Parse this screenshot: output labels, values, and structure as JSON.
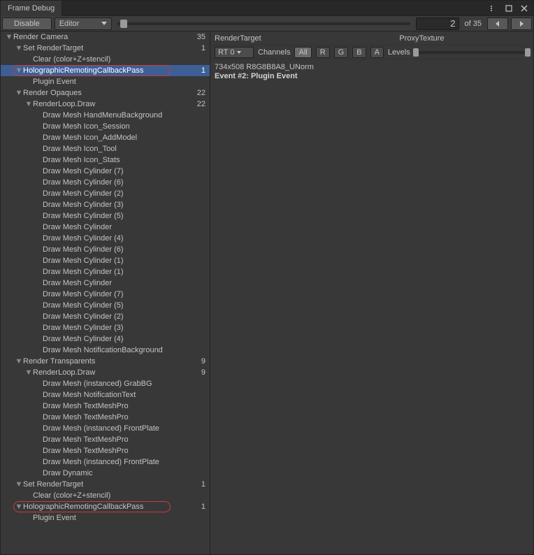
{
  "window": {
    "title": "Frame Debug"
  },
  "toolbar": {
    "disable": "Disable",
    "scope": "Editor",
    "current": "2",
    "total": "35",
    "of": "of"
  },
  "detail": {
    "renderTargetLabel": "RenderTarget",
    "renderTargetValue": "ProxyTexture",
    "rt": "RT 0",
    "channelsLabel": "Channels",
    "channels": [
      "All",
      "R",
      "G",
      "B",
      "A"
    ],
    "levelsLabel": "Levels",
    "texInfo": "734x508 R8G8B8A8_UNorm",
    "eventLine": "Event #2: Plugin Event"
  },
  "tree": [
    {
      "d": 0,
      "f": true,
      "label": "Render Camera",
      "count": "35"
    },
    {
      "d": 1,
      "f": true,
      "label": "Set RenderTarget",
      "count": "1"
    },
    {
      "d": 2,
      "f": false,
      "label": "Clear (color+Z+stencil)"
    },
    {
      "d": 1,
      "f": true,
      "label": "HolographicRemotingCallbackPass",
      "count": "1",
      "selected": true,
      "circled": true
    },
    {
      "d": 2,
      "f": false,
      "label": "Plugin Event"
    },
    {
      "d": 1,
      "f": true,
      "label": "Render Opaques",
      "count": "22"
    },
    {
      "d": 2,
      "f": true,
      "label": "RenderLoop.Draw",
      "count": "22"
    },
    {
      "d": 3,
      "f": false,
      "label": "Draw Mesh HandMenuBackground"
    },
    {
      "d": 3,
      "f": false,
      "label": "Draw Mesh Icon_Session"
    },
    {
      "d": 3,
      "f": false,
      "label": "Draw Mesh Icon_AddModel"
    },
    {
      "d": 3,
      "f": false,
      "label": "Draw Mesh Icon_Tool"
    },
    {
      "d": 3,
      "f": false,
      "label": "Draw Mesh Icon_Stats"
    },
    {
      "d": 3,
      "f": false,
      "label": "Draw Mesh Cylinder (7)"
    },
    {
      "d": 3,
      "f": false,
      "label": "Draw Mesh Cylinder (6)"
    },
    {
      "d": 3,
      "f": false,
      "label": "Draw Mesh Cylinder (2)"
    },
    {
      "d": 3,
      "f": false,
      "label": "Draw Mesh Cylinder (3)"
    },
    {
      "d": 3,
      "f": false,
      "label": "Draw Mesh Cylinder (5)"
    },
    {
      "d": 3,
      "f": false,
      "label": "Draw Mesh Cylinder"
    },
    {
      "d": 3,
      "f": false,
      "label": "Draw Mesh Cylinder (4)"
    },
    {
      "d": 3,
      "f": false,
      "label": "Draw Mesh Cylinder (6)"
    },
    {
      "d": 3,
      "f": false,
      "label": "Draw Mesh Cylinder (1)"
    },
    {
      "d": 3,
      "f": false,
      "label": "Draw Mesh Cylinder (1)"
    },
    {
      "d": 3,
      "f": false,
      "label": "Draw Mesh Cylinder"
    },
    {
      "d": 3,
      "f": false,
      "label": "Draw Mesh Cylinder (7)"
    },
    {
      "d": 3,
      "f": false,
      "label": "Draw Mesh Cylinder (5)"
    },
    {
      "d": 3,
      "f": false,
      "label": "Draw Mesh Cylinder (2)"
    },
    {
      "d": 3,
      "f": false,
      "label": "Draw Mesh Cylinder (3)"
    },
    {
      "d": 3,
      "f": false,
      "label": "Draw Mesh Cylinder (4)"
    },
    {
      "d": 3,
      "f": false,
      "label": "Draw Mesh NotificationBackground"
    },
    {
      "d": 1,
      "f": true,
      "label": "Render Transparents",
      "count": "9"
    },
    {
      "d": 2,
      "f": true,
      "label": "RenderLoop.Draw",
      "count": "9"
    },
    {
      "d": 3,
      "f": false,
      "label": "Draw Mesh (instanced) GrabBG"
    },
    {
      "d": 3,
      "f": false,
      "label": "Draw Mesh NotificationText"
    },
    {
      "d": 3,
      "f": false,
      "label": "Draw Mesh TextMeshPro"
    },
    {
      "d": 3,
      "f": false,
      "label": "Draw Mesh TextMeshPro"
    },
    {
      "d": 3,
      "f": false,
      "label": "Draw Mesh (instanced) FrontPlate"
    },
    {
      "d": 3,
      "f": false,
      "label": "Draw Mesh TextMeshPro"
    },
    {
      "d": 3,
      "f": false,
      "label": "Draw Mesh TextMeshPro"
    },
    {
      "d": 3,
      "f": false,
      "label": "Draw Mesh (instanced) FrontPlate"
    },
    {
      "d": 3,
      "f": false,
      "label": "Draw Dynamic"
    },
    {
      "d": 1,
      "f": true,
      "label": "Set RenderTarget",
      "count": "1"
    },
    {
      "d": 2,
      "f": false,
      "label": "Clear (color+Z+stencil)"
    },
    {
      "d": 1,
      "f": true,
      "label": "HolographicRemotingCallbackPass",
      "count": "1",
      "circled": true
    },
    {
      "d": 2,
      "f": false,
      "label": "Plugin Event"
    }
  ]
}
